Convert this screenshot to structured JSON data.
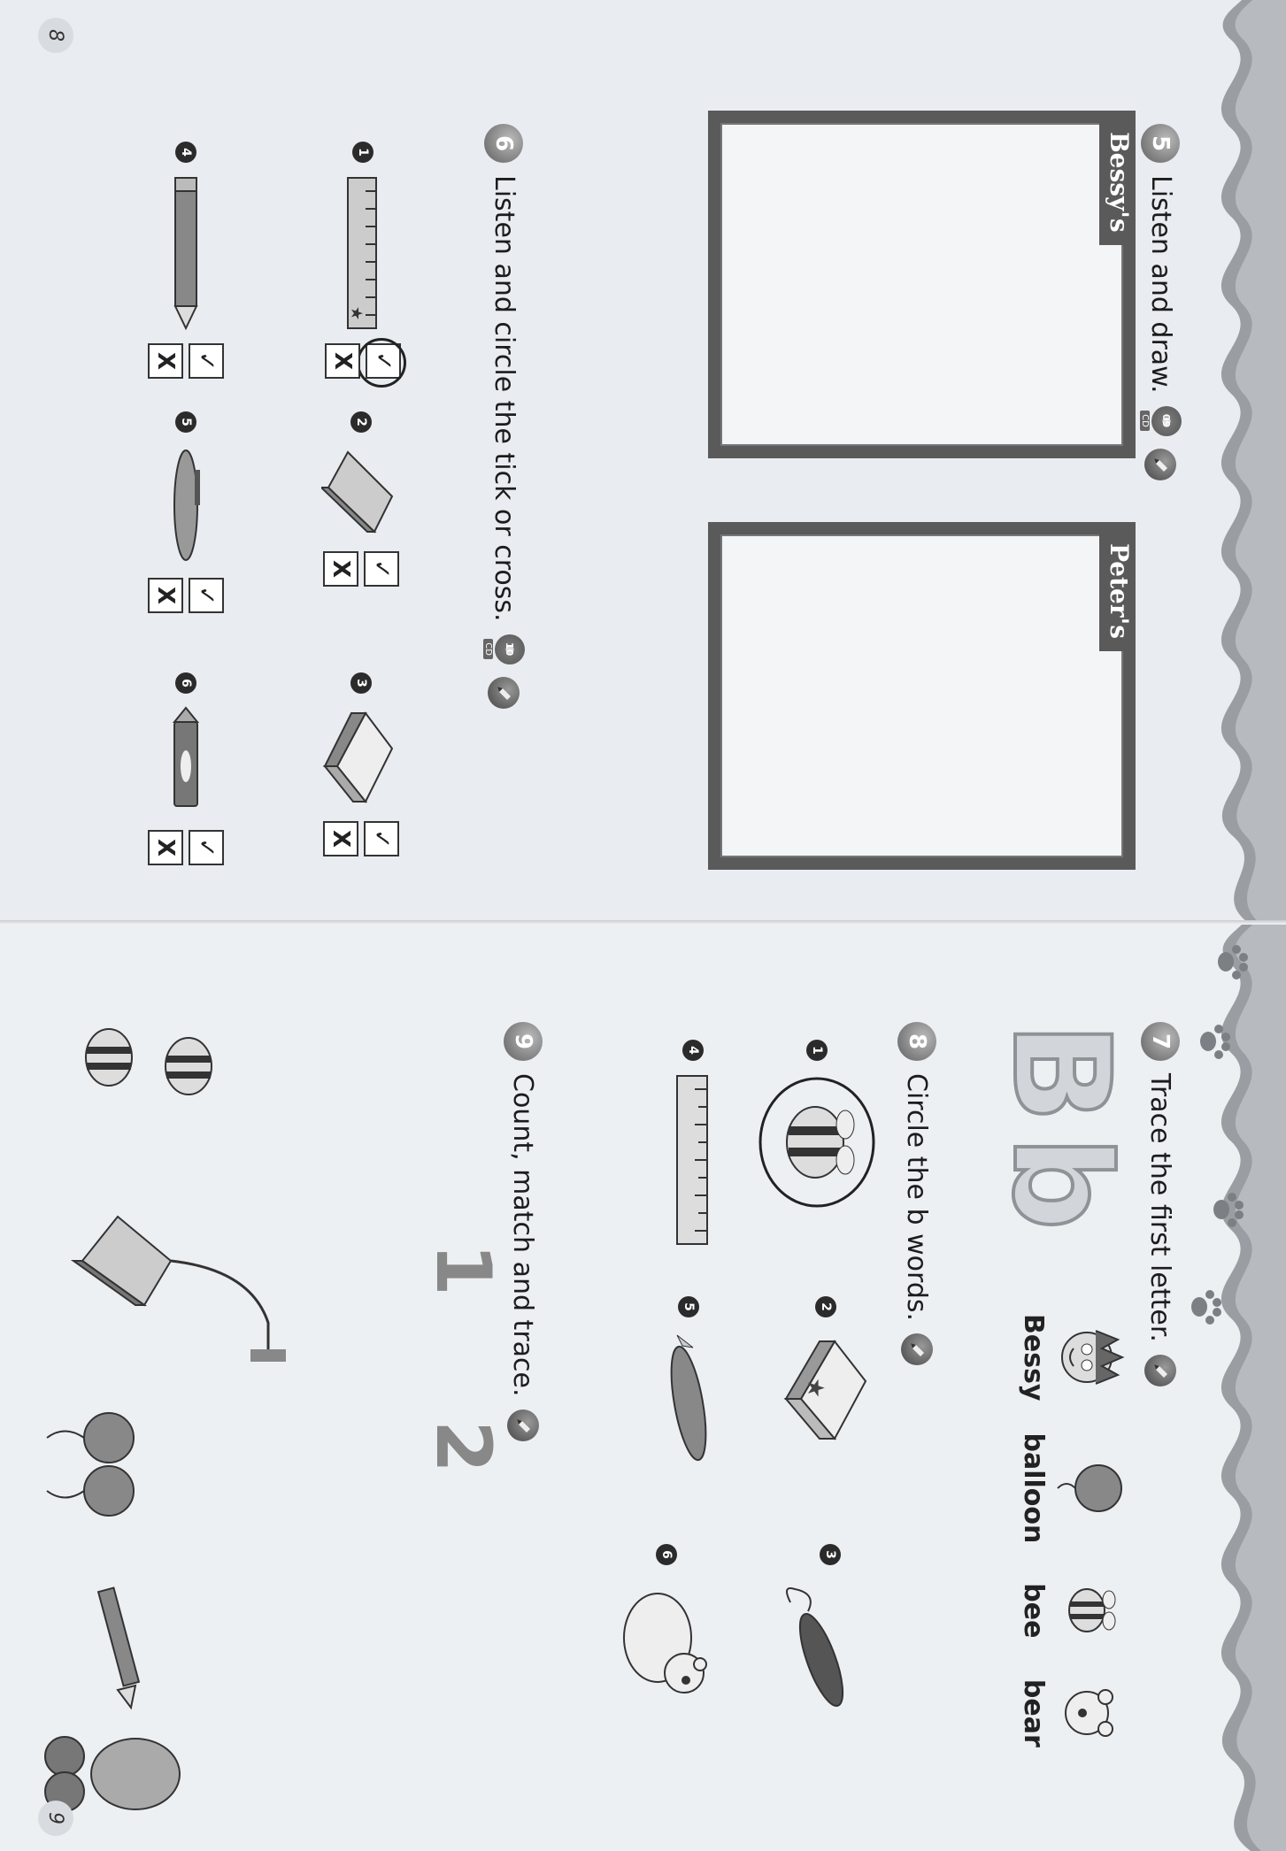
{
  "left_page": {
    "page_number": "8",
    "task5": {
      "number": "5",
      "instruction": "Listen and draw.",
      "cd_track": "09",
      "cd_label": "CD"
    },
    "frames": [
      {
        "label": "Bessy's"
      },
      {
        "label": "Peter's"
      }
    ],
    "task6": {
      "number": "6",
      "instruction": "Listen and circle the tick or cross.",
      "cd_track": "10",
      "cd_label": "CD"
    },
    "tick_cross_items": [
      {
        "number": "1",
        "object": "ruler",
        "tick": "✓",
        "cross": "X",
        "circled": "tick"
      },
      {
        "number": "2",
        "object": "notebook",
        "tick": "✓",
        "cross": "X",
        "circled": ""
      },
      {
        "number": "3",
        "object": "eraser",
        "tick": "✓",
        "cross": "X",
        "circled": ""
      },
      {
        "number": "4",
        "object": "pencil",
        "tick": "✓",
        "cross": "X",
        "circled": ""
      },
      {
        "number": "5",
        "object": "pen",
        "tick": "✓",
        "cross": "X",
        "circled": ""
      },
      {
        "number": "6",
        "object": "crayon",
        "tick": "✓",
        "cross": "X",
        "circled": ""
      }
    ]
  },
  "right_page": {
    "page_number": "9",
    "task7": {
      "number": "7",
      "instruction": "Trace the first letter.",
      "upper": "B",
      "lower": "b"
    },
    "words": [
      "Bessy",
      "balloon",
      "bee",
      "bear"
    ],
    "task8": {
      "number": "8",
      "instruction": "Circle the b words."
    },
    "circle_items": [
      {
        "number": "1",
        "object": "bee",
        "circled": true
      },
      {
        "number": "2",
        "object": "eraser",
        "circled": false
      },
      {
        "number": "3",
        "object": "balloon",
        "circled": false
      },
      {
        "number": "4",
        "object": "ruler",
        "circled": false
      },
      {
        "number": "5",
        "object": "pen",
        "circled": false
      },
      {
        "number": "6",
        "object": "bear",
        "circled": false
      }
    ],
    "task9": {
      "number": "9",
      "instruction": "Count, match and trace.",
      "digits": [
        "1",
        "2"
      ]
    }
  },
  "colors": {
    "background": "#1fa64a",
    "page": "#eceff2",
    "frame": "#5a5a5a"
  },
  "icons": [
    "pencil-icon",
    "cd-icon",
    "paw-icon"
  ]
}
